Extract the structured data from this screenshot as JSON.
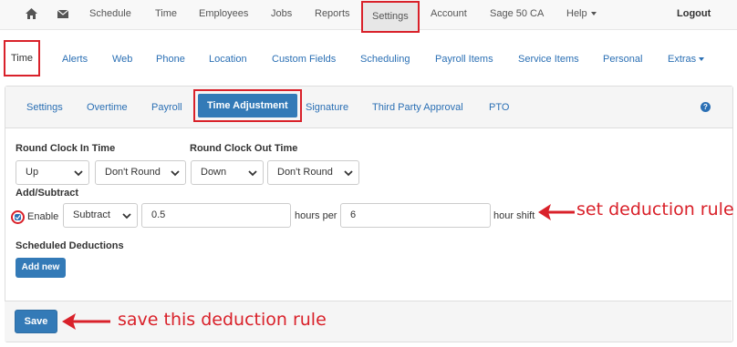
{
  "topnav": {
    "home_icon": "home-icon",
    "mail_icon": "envelope-icon",
    "items": [
      "Schedule",
      "Time",
      "Employees",
      "Jobs",
      "Reports",
      "Settings",
      "Account",
      "Sage 50 CA",
      "Help"
    ],
    "logout": "Logout"
  },
  "subnav": {
    "tabs": [
      "Time",
      "Alerts",
      "Web",
      "Phone",
      "Location",
      "Custom Fields",
      "Scheduling",
      "Payroll Items",
      "Service Items",
      "Personal",
      "Extras"
    ]
  },
  "panel": {
    "tabs": [
      "Settings",
      "Overtime",
      "Payroll",
      "Time Adjustment",
      "Signature",
      "Third Party Approval",
      "PTO"
    ],
    "help_icon": "question-circle-icon",
    "round_in_label": "Round Clock In Time",
    "round_out_label": "Round Clock Out Time",
    "round_in_direction": "Up",
    "round_in_mode": "Don't Round",
    "round_out_direction": "Down",
    "round_out_mode": "Don't Round",
    "add_subtract_label": "Add/Subtract",
    "enable_label": "Enable",
    "enable_checked": true,
    "operation": "Subtract",
    "hours_value": "0.5",
    "hours_per_label": "hours per",
    "shift_value": "6",
    "hour_shift_label": "hour shift",
    "scheduled_label": "Scheduled Deductions",
    "add_new": "Add new",
    "save": "Save"
  },
  "annotations": {
    "set_rule": "set deduction rule",
    "save_rule": "save this deduction rule",
    "color": "#d9212a"
  }
}
